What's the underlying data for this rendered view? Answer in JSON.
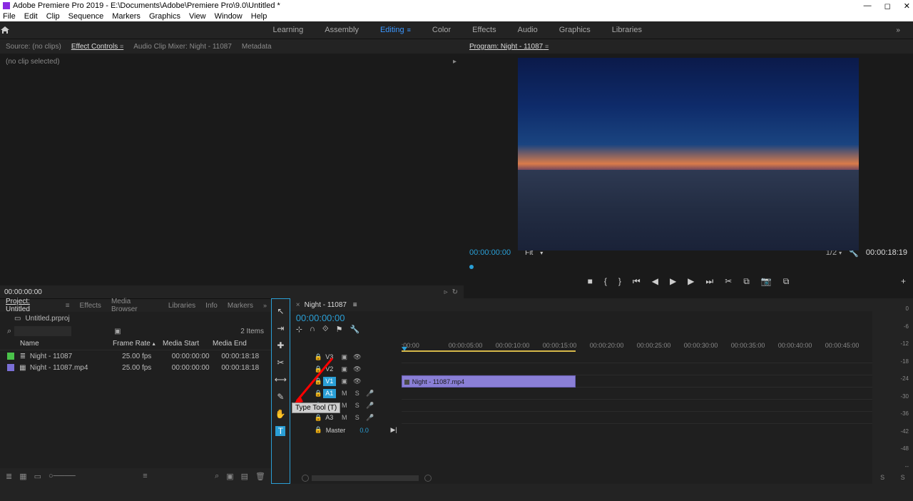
{
  "title": "Adobe Premiere Pro 2019 - E:\\Documents\\Adobe\\Premiere Pro\\9.0\\Untitled *",
  "menu": [
    "File",
    "Edit",
    "Clip",
    "Sequence",
    "Markers",
    "Graphics",
    "View",
    "Window",
    "Help"
  ],
  "workspaces": [
    "Learning",
    "Assembly",
    "Editing",
    "Color",
    "Effects",
    "Audio",
    "Graphics",
    "Libraries"
  ],
  "active_workspace": "Editing",
  "source_tabs": [
    "Source: (no clips)",
    "Effect Controls",
    "Audio Clip Mixer: Night - 11087",
    "Metadata"
  ],
  "source_active": "Effect Controls",
  "source_body": "(no clip selected)",
  "source_tc": "00:00:00:00",
  "program": {
    "title": "Program: Night - 11087",
    "tc_left": "00:00:00:00",
    "fit": "Fit",
    "zoom": "1/2",
    "tc_right": "00:00:18:19"
  },
  "transport": [
    "■",
    "{",
    "}",
    "⏮",
    "◀",
    "▶",
    "▶",
    "⏭",
    "✂",
    "⧉",
    "📷",
    "⧉"
  ],
  "project_tabs": [
    "Project: Untitled",
    "Effects",
    "Media Browser",
    "Libraries",
    "Info",
    "Markers"
  ],
  "project_active": "Project: Untitled",
  "bin_name": "Untitled.prproj",
  "item_count": "2 Items",
  "columns": {
    "name": "Name",
    "fr": "Frame Rate",
    "ms": "Media Start",
    "me": "Media End"
  },
  "items": [
    {
      "color": "#4ac24a",
      "icon": "≣",
      "name": "Night - 11087",
      "fr": "25.00 fps",
      "ms": "00:00:00:00",
      "me": "00:00:18:18"
    },
    {
      "color": "#7a6fd6",
      "icon": "▦",
      "name": "Night - 11087.mp4",
      "fr": "25.00 fps",
      "ms": "00:00:00:00",
      "me": "00:00:18:18"
    }
  ],
  "tools": [
    "↖",
    "⇥",
    "✚",
    "✂",
    "⟷",
    "✎",
    "✋",
    "T"
  ],
  "tool_tooltip": "Type Tool (T)",
  "timeline": {
    "name": "Night - 11087",
    "tc": "00:00:00:00",
    "ruler": [
      ":00:00",
      "00:00:05:00",
      "00:00:10:00",
      "00:00:15:00",
      "00:00:20:00",
      "00:00:25:00",
      "00:00:30:00",
      "00:00:35:00",
      "00:00:40:00",
      "00:00:45:00"
    ],
    "video": [
      "V3",
      "V2",
      "V1"
    ],
    "audio": [
      "A1",
      "A2",
      "A3"
    ],
    "master": "Master",
    "master_val": "0.0",
    "clip": "Night - 11087.mp4"
  },
  "meter_scale": [
    "0",
    "-6",
    "-12",
    "-18",
    "-24",
    "-30",
    "-36",
    "-42",
    "-48",
    "--"
  ],
  "meter_footer": [
    "S",
    "S"
  ]
}
